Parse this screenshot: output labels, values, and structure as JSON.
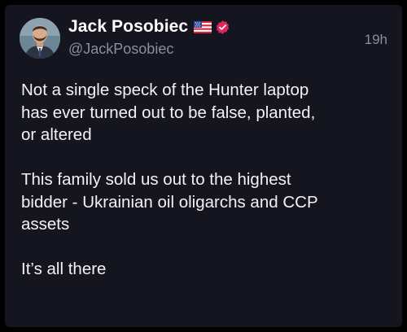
{
  "post": {
    "author": {
      "name": "Jack Posobiec",
      "handle": "@JackPosobiec",
      "flag_icon": "us-flag-icon",
      "verified_icon": "verified-badge-icon",
      "verified_color": "#e0245e"
    },
    "timestamp": "19h",
    "paragraphs": [
      {
        "lines": [
          "Not a single speck of the Hunter laptop",
          "has ever turned out to be false, planted,",
          "or altered"
        ]
      },
      {
        "lines": [
          "This family sold us out to the highest",
          "bidder - Ukrainian oil oligarchs and CCP",
          "assets"
        ]
      },
      {
        "lines": [
          "It’s all there"
        ]
      }
    ]
  },
  "colors": {
    "background": "#151520",
    "text": "#f2f2f5",
    "secondary_text": "#8e8e99"
  }
}
